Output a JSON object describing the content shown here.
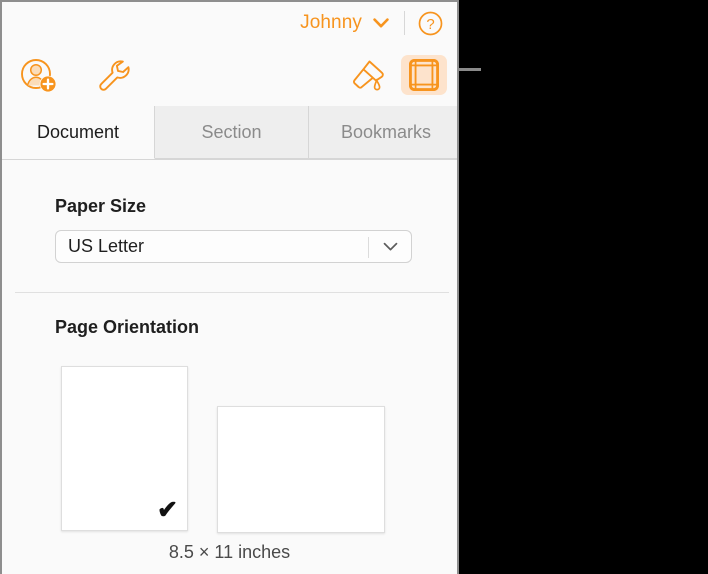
{
  "account": {
    "name": "Johnny",
    "chevron_icon": "chevron-down-icon",
    "help_icon": "question-mark-circle-icon"
  },
  "toolbar": {
    "left_tools": [
      {
        "icon": "add-collaborator-icon",
        "label": "Add People"
      },
      {
        "icon": "wrench-icon",
        "label": "Tools"
      }
    ],
    "right_tools": [
      {
        "icon": "format-paint-icon",
        "label": "Format",
        "active": false
      },
      {
        "icon": "document-setup-icon",
        "label": "Document",
        "active": true
      }
    ],
    "accent_color": "#f7941e",
    "active_background": "#fde3cc"
  },
  "tabs": [
    {
      "label": "Document",
      "active": true
    },
    {
      "label": "Section",
      "active": false
    },
    {
      "label": "Bookmarks",
      "active": false
    }
  ],
  "paper_size": {
    "label": "Paper Size",
    "value": "US Letter",
    "arrow_icon": "chevron-down-icon"
  },
  "page_orientation": {
    "label": "Page Orientation",
    "options": [
      {
        "name": "portrait",
        "selected": true,
        "check_glyph": "✔"
      },
      {
        "name": "landscape",
        "selected": false
      }
    ],
    "size_caption": "8.5 × 11 inches"
  }
}
